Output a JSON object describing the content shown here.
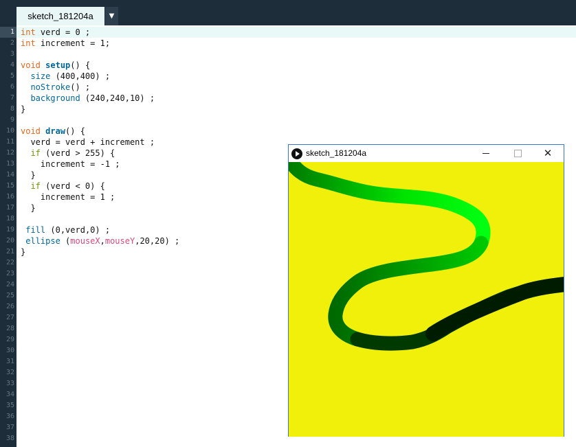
{
  "tab": {
    "label": "sketch_181204a",
    "menu_arrow": "▼"
  },
  "editor": {
    "current_line": 1,
    "line_count": 38,
    "lines": [
      [
        {
          "t": "int",
          "c": "kw-type"
        },
        {
          "t": " verd = 0 ;"
        }
      ],
      [
        {
          "t": "int",
          "c": "kw-type"
        },
        {
          "t": " increment = 1;"
        }
      ],
      [],
      [
        {
          "t": "void",
          "c": "kw-type"
        },
        {
          "t": " "
        },
        {
          "t": "setup",
          "c": "kw-fn"
        },
        {
          "t": "() {"
        }
      ],
      [
        {
          "t": "  "
        },
        {
          "t": "size",
          "c": "fn-call"
        },
        {
          "t": " (400,400) ;"
        }
      ],
      [
        {
          "t": "  "
        },
        {
          "t": "noStroke",
          "c": "fn-call"
        },
        {
          "t": "() ;"
        }
      ],
      [
        {
          "t": "  "
        },
        {
          "t": "background",
          "c": "fn-call"
        },
        {
          "t": " (240,240,10) ;"
        }
      ],
      [
        {
          "t": "}"
        }
      ],
      [],
      [
        {
          "t": "void",
          "c": "kw-type"
        },
        {
          "t": " "
        },
        {
          "t": "draw",
          "c": "kw-fn"
        },
        {
          "t": "() {"
        }
      ],
      [
        {
          "t": "  verd = verd + increment ;"
        }
      ],
      [
        {
          "t": "  "
        },
        {
          "t": "if",
          "c": "kw-ctl"
        },
        {
          "t": " (verd > 255) {"
        }
      ],
      [
        {
          "t": "    increment = -1 ;"
        }
      ],
      [
        {
          "t": "  }"
        }
      ],
      [
        {
          "t": "  "
        },
        {
          "t": "if",
          "c": "kw-ctl"
        },
        {
          "t": " (verd < 0) {"
        }
      ],
      [
        {
          "t": "    increment = 1 ;"
        }
      ],
      [
        {
          "t": "  }"
        }
      ],
      [],
      [
        {
          "t": " "
        },
        {
          "t": "fill",
          "c": "fn-call"
        },
        {
          "t": " (0,verd,0) ;"
        }
      ],
      [
        {
          "t": " "
        },
        {
          "t": "ellipse",
          "c": "fn-call"
        },
        {
          "t": " ("
        },
        {
          "t": "mouseX",
          "c": "var-sys"
        },
        {
          "t": ","
        },
        {
          "t": "mouseY",
          "c": "var-sys"
        },
        {
          "t": ",20,20) ;"
        }
      ],
      [
        {
          "t": "}"
        }
      ]
    ]
  },
  "sketch_window": {
    "title": "sketch_181204a",
    "close_glyph": "✕",
    "canvas_background": "#f0f00a"
  },
  "colors": {
    "ide_dark": "#1e2d3a",
    "keyword_type": "#e2661a",
    "keyword_control": "#669900",
    "function": "#006699",
    "system_variable": "#d94a7a",
    "window_border": "#3b77c9"
  }
}
